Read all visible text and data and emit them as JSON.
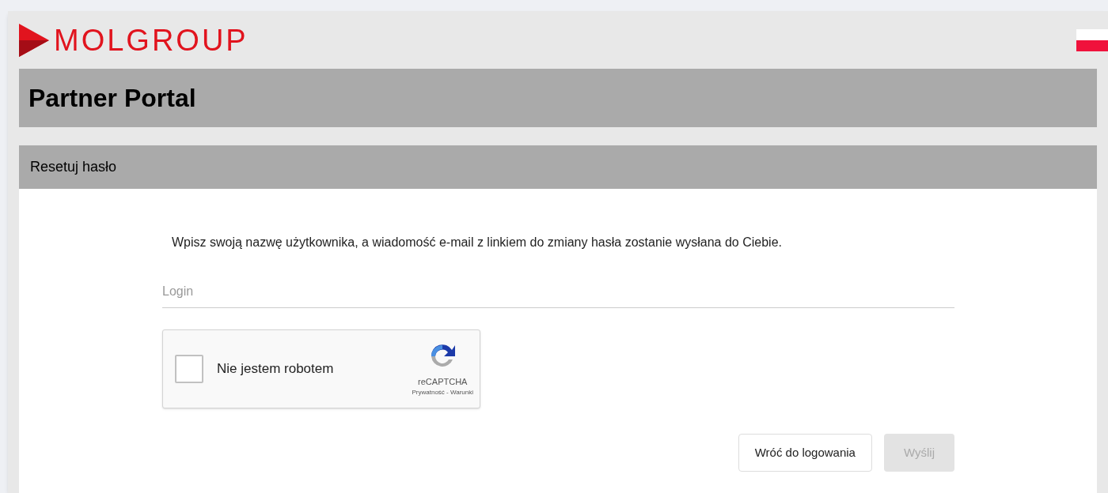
{
  "header": {
    "logo": "MOLGROUP"
  },
  "title": "Partner Portal",
  "section": {
    "title": "Resetuj hasło"
  },
  "form": {
    "instructions": "Wpisz swoją nazwę użytkownika, a wiadomość e-mail z linkiem do zmiany hasła zostanie wysłana do Ciebie.",
    "login": {
      "placeholder": "Login"
    },
    "captcha": {
      "label": "Nie jestem robotem",
      "checked": false,
      "brand": "reCAPTCHA",
      "links": "Prywatność - Warunki"
    },
    "buttons": [
      {
        "label": "Wróć do logowania",
        "disabled": false
      },
      {
        "label": "Wyślij",
        "disabled": true
      }
    ]
  }
}
